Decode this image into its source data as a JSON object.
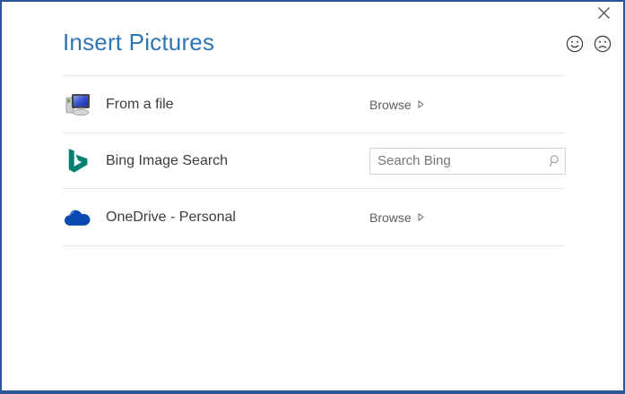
{
  "window": {
    "title": "Insert Pictures"
  },
  "header": {
    "close_icon": "close-icon",
    "feedback_icons": [
      "smiley-happy-icon",
      "smiley-sad-icon"
    ]
  },
  "rows": [
    {
      "label": "From a file",
      "icon": "computer-icon",
      "action_label": "Browse"
    },
    {
      "label": "Bing Image Search",
      "icon": "bing-icon",
      "search_value": "",
      "search_placeholder": "Search Bing"
    },
    {
      "label": "OneDrive - Personal",
      "icon": "onedrive-icon",
      "action_label": "Browse"
    }
  ],
  "colors": {
    "dialog_border": "#2b5797",
    "title_blue": "#2e75b6",
    "label_gray": "#3c3c3c",
    "browse_gray": "#5d5d5d",
    "separator": "#e4e4e4",
    "bing_teal": "#008272",
    "onedrive_blue": "#094ab2"
  }
}
